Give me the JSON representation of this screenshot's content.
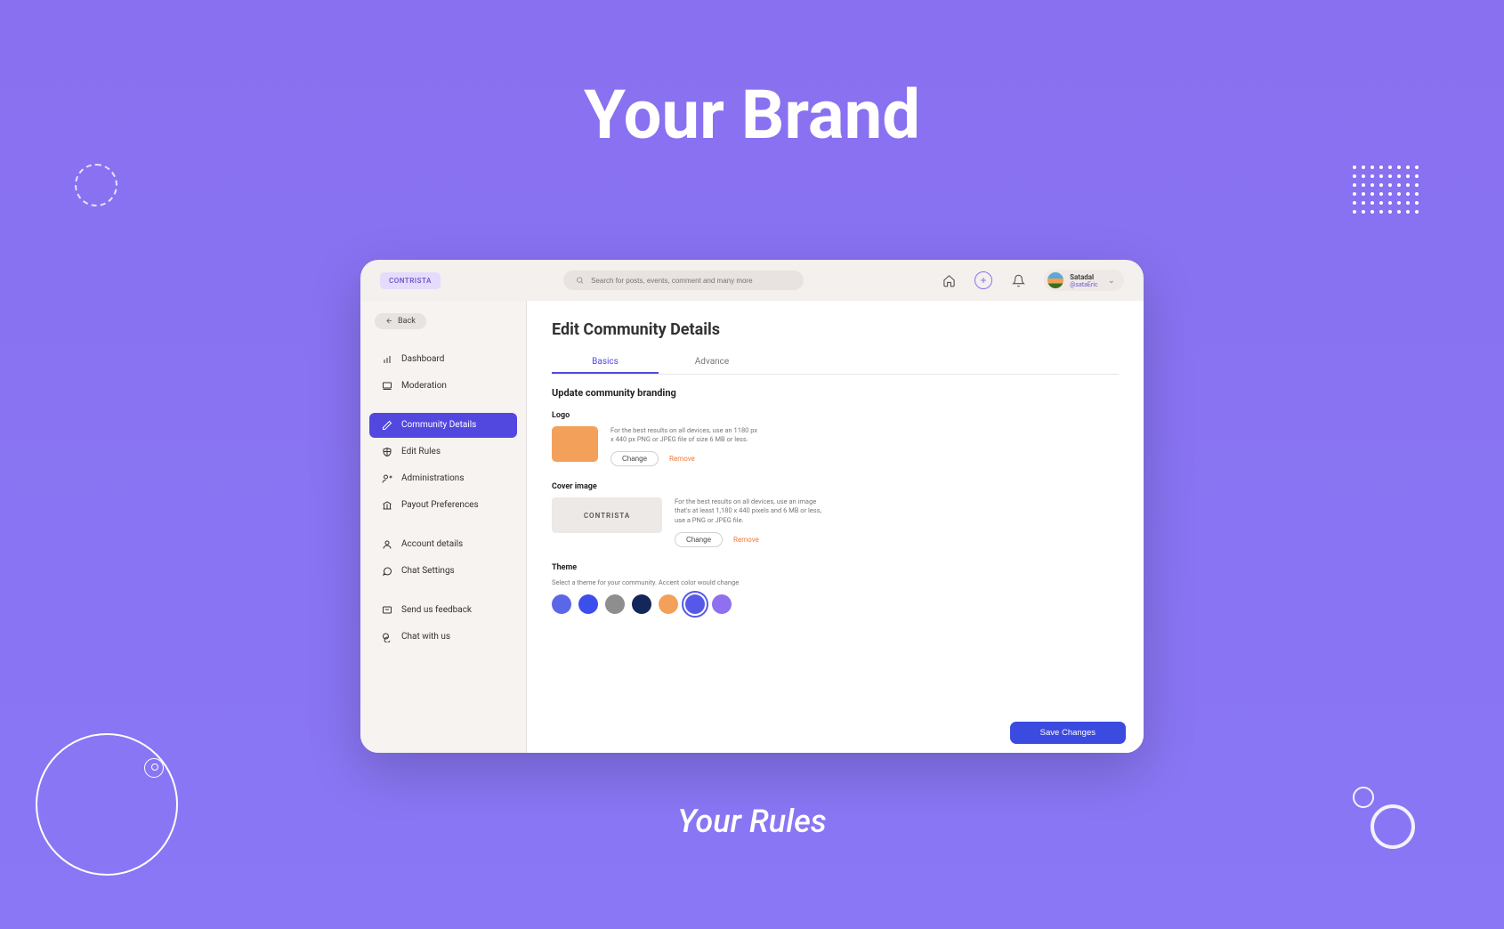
{
  "hero": {
    "title": "Your Brand",
    "subtitle": "Your Rules"
  },
  "app": {
    "brand": "CONTRISTA",
    "search_placeholder": "Search for posts, events, comment and many more",
    "user": {
      "name": "Satadal",
      "handle": "@sataEric"
    },
    "back_label": "Back"
  },
  "sidebar": {
    "group1": [
      {
        "label": "Dashboard"
      },
      {
        "label": "Moderation"
      }
    ],
    "group2": [
      {
        "label": "Community Details",
        "active": true
      },
      {
        "label": "Edit Rules"
      },
      {
        "label": "Administrations"
      },
      {
        "label": "Payout Preferences"
      }
    ],
    "group3": [
      {
        "label": "Account details"
      },
      {
        "label": "Chat Settings"
      }
    ],
    "group4": [
      {
        "label": "Send us feedback"
      },
      {
        "label": "Chat with us"
      }
    ]
  },
  "main": {
    "title": "Edit Community Details",
    "tabs": {
      "basics": "Basics",
      "advance": "Advance"
    },
    "section_heading": "Update community branding",
    "logo": {
      "label": "Logo",
      "hint": "For the best results on all devices, use an 1180 px x 440 px PNG or JPEG file of size 6 MB or less.",
      "change": "Change",
      "remove": "Remove"
    },
    "cover": {
      "label": "Cover image",
      "preview_text": "CONTRISTA",
      "hint": "For the best results on all devices, use an image that's at least 1,180 x 440 pixels and 6 MB or less, use a PNG or JPEG file.",
      "change": "Change",
      "remove": "Remove"
    },
    "theme": {
      "label": "Theme",
      "hint": "Select a theme for your community. Accent color would change",
      "swatches": [
        "#5a68e8",
        "#3d4feb",
        "#8e8e8e",
        "#13275a",
        "#f3a15a",
        "#5659e8",
        "#8e70f0"
      ],
      "selected_index": 5
    },
    "save_label": "Save Changes"
  }
}
